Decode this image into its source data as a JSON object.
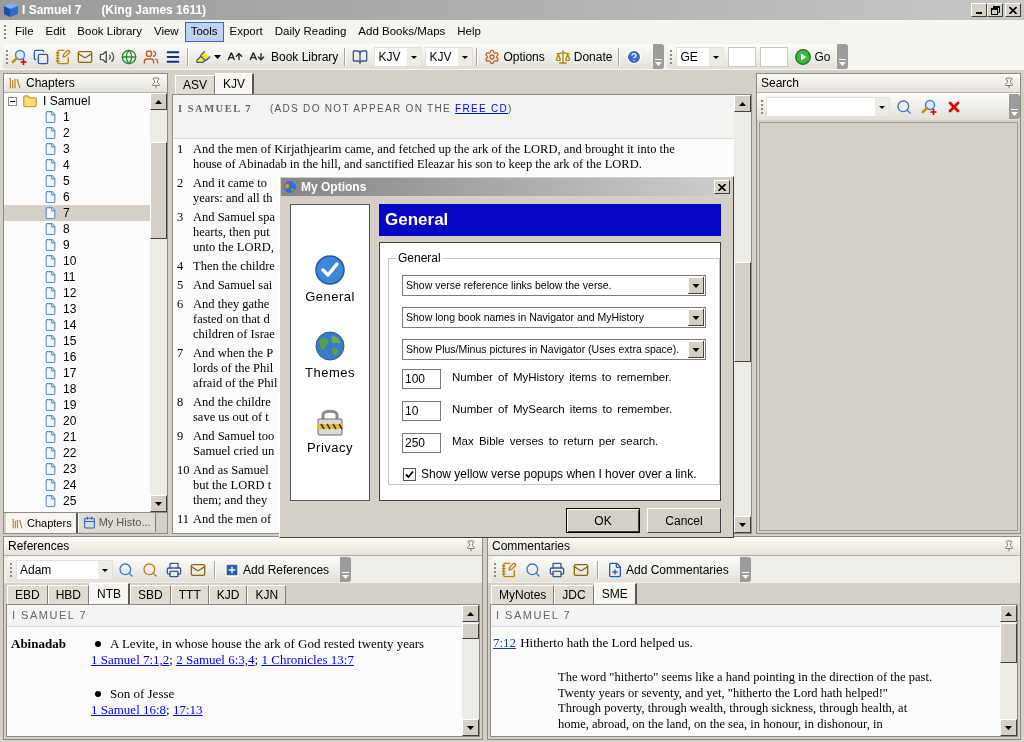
{
  "window": {
    "title": "I Samuel 7",
    "subtitle": "(King James 1611)"
  },
  "menu": [
    {
      "label": "File",
      "selected": false
    },
    {
      "label": "Edit",
      "selected": false
    },
    {
      "label": "Book Library",
      "selected": false
    },
    {
      "label": "View",
      "selected": false
    },
    {
      "label": "Tools",
      "selected": true
    },
    {
      "label": "Export",
      "selected": false
    },
    {
      "label": "Daily Reading",
      "selected": false
    },
    {
      "label": "Add Books/Maps",
      "selected": false
    },
    {
      "label": "Help",
      "selected": false
    }
  ],
  "toolbar": {
    "library_button": "Book Library",
    "version_selects": [
      "KJV",
      "KJV"
    ],
    "options_button": "Options",
    "donate_button": "Donate"
  },
  "navigator": {
    "book_select": "GE",
    "go_button": "Go"
  },
  "chapters_panel": {
    "title": "Chapters",
    "tree": [
      {
        "label": "I Samuel",
        "expanded": true,
        "selected": false,
        "children": [
          {
            "label": "1",
            "selected": false
          },
          {
            "label": "2",
            "selected": false
          },
          {
            "label": "3",
            "selected": false
          },
          {
            "label": "4",
            "selected": false
          },
          {
            "label": "5",
            "selected": false
          },
          {
            "label": "6",
            "selected": false
          },
          {
            "label": "7",
            "selected": true
          },
          {
            "label": "8",
            "selected": false
          },
          {
            "label": "9",
            "selected": false
          },
          {
            "label": "10",
            "selected": false
          },
          {
            "label": "11",
            "selected": false
          },
          {
            "label": "12",
            "selected": false
          },
          {
            "label": "13",
            "selected": false
          },
          {
            "label": "14",
            "selected": false
          },
          {
            "label": "15",
            "selected": false
          },
          {
            "label": "16",
            "selected": false
          },
          {
            "label": "17",
            "selected": false
          },
          {
            "label": "18",
            "selected": false
          },
          {
            "label": "19",
            "selected": false
          },
          {
            "label": "20",
            "selected": false
          },
          {
            "label": "21",
            "selected": false
          },
          {
            "label": "22",
            "selected": false
          },
          {
            "label": "23",
            "selected": false
          },
          {
            "label": "24",
            "selected": false
          },
          {
            "label": "25",
            "selected": false
          }
        ]
      }
    ],
    "tabs": [
      {
        "label": "Chapters",
        "selected": true
      },
      {
        "label": "My Histo...",
        "selected": false
      }
    ]
  },
  "bible_panel": {
    "tabs": [
      {
        "label": "ASV",
        "selected": false
      },
      {
        "label": "KJV",
        "selected": true
      }
    ],
    "heading": "I SAMUEL 7",
    "ad_notice": {
      "before": "(ADS DO NOT APPEAR ON THE ",
      "link": "FREE CD",
      "after": ")"
    },
    "verses": [
      {
        "number": "1",
        "lines": [
          "And the men of Kirjathjearim came, and fetched up the ark of the LORD, and brought it into the",
          "house of Abinadab in the hill, and sanctified Eleazar his son to keep the ark of the LORD."
        ]
      },
      {
        "number": "2",
        "lines": [
          "And it came to",
          "years: and all th"
        ]
      },
      {
        "number": "3",
        "lines": [
          "And Samuel spa",
          "hearts, then put",
          "unto the LORD,"
        ]
      },
      {
        "number": "4",
        "lines": [
          "Then the childre"
        ]
      },
      {
        "number": "5",
        "lines": [
          "And Samuel sai"
        ]
      },
      {
        "number": "6",
        "lines": [
          "And they gathe",
          "fasted on that d",
          "children of Israe"
        ]
      },
      {
        "number": "7",
        "lines": [
          "And when the P",
          "lords of the Phil",
          "afraid of the Phil"
        ]
      },
      {
        "number": "8",
        "lines": [
          "And the childre",
          "save us out of t"
        ]
      },
      {
        "number": "9",
        "lines": [
          "And Samuel too",
          "Samuel cried un"
        ]
      },
      {
        "number": "10",
        "lines": [
          "And as Samuel",
          "but the LORD t",
          "them; and they"
        ]
      },
      {
        "number": "11",
        "lines": [
          "And the men of"
        ]
      }
    ]
  },
  "search_panel": {
    "title": "Search"
  },
  "references_panel": {
    "title": "References",
    "lookup": "Adam",
    "add_button": "Add References",
    "tabs": [
      {
        "label": "EBD",
        "selected": false
      },
      {
        "label": "HBD",
        "selected": false
      },
      {
        "label": "NTB",
        "selected": true
      },
      {
        "label": "SBD",
        "selected": false
      },
      {
        "label": "TTT",
        "selected": false
      },
      {
        "label": "KJD",
        "selected": false
      },
      {
        "label": "KJN",
        "selected": false
      }
    ],
    "heading": "I SAMUEL 7",
    "link_separator": "; ",
    "entries": [
      {
        "term": "Abinadab",
        "definitions": [
          {
            "text": "A Levite, in whose house the ark of God rested twenty years",
            "links": [
              "1 Samuel 7:1,2",
              "2 Samuel 6:3,4",
              "1 Chronicles 13:7"
            ]
          },
          {
            "text": "Son of Jesse",
            "links": [
              "1 Samuel 16:8",
              "17:13"
            ]
          }
        ]
      }
    ]
  },
  "commentaries_panel": {
    "title": "Commentaries",
    "add_button": "Add Commentaries",
    "tabs": [
      {
        "label": "MyNotes",
        "selected": false
      },
      {
        "label": "JDC",
        "selected": false
      },
      {
        "label": "SME",
        "selected": true
      }
    ],
    "heading": "I SAMUEL 7",
    "verse_link": "7:12",
    "verse_title": "Hitherto hath the Lord helped us.",
    "body_lines": [
      "The word \"hitherto\" seems like a hand pointing in the direction of the past.",
      "Twenty years or seventy, and yet, \"hitherto the Lord hath helped!\"",
      "Through poverty, through wealth, through sickness, through health, at",
      "home, abroad, on the land, on the sea, in honour, in dishonour, in"
    ]
  },
  "options_dialog": {
    "title": "My Options",
    "categories": [
      {
        "label": "General",
        "kind": "check"
      },
      {
        "label": "Themes",
        "kind": "globe"
      },
      {
        "label": "Privacy",
        "kind": "lock"
      }
    ],
    "page_title": "General",
    "group_title": "General",
    "dropdowns": [
      "Show verse reference links below the verse.",
      "Show long book names in Navigator and MyHistory",
      "Show Plus/Minus pictures in Navigator (Uses extra space)."
    ],
    "number_settings": [
      {
        "value": "100",
        "label": "Number of MyHistory items to remember."
      },
      {
        "value": "10",
        "label": "Number of MySearch items to remember."
      },
      {
        "value": "250",
        "label": "Max Bible verses to return per search."
      }
    ],
    "checkbox": {
      "label": "Show yellow verse popups when I hover over a link.",
      "checked": true
    },
    "buttons": [
      "OK",
      "Cancel"
    ]
  }
}
